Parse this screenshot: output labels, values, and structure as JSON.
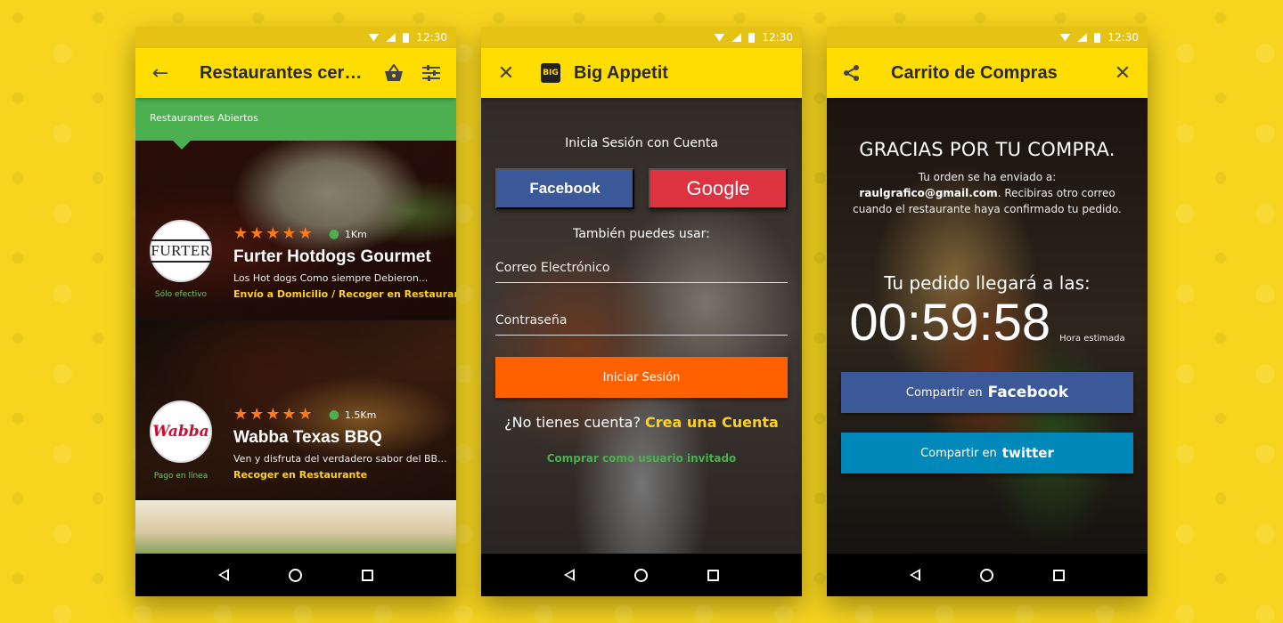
{
  "status_bar": {
    "time": "12:30"
  },
  "phone1": {
    "title": "Restaurantes cerca...",
    "banner": "Restaurantes Abiertos",
    "restaurants": [
      {
        "logo_text": "FURTER",
        "payment": "Sólo efectivo",
        "rating": 5,
        "distance": "1Km",
        "name": "Furter Hotdogs Gourmet",
        "description": "Los Hot dogs Como siempre Debieron...",
        "delivery": "Envío a Domicilio / Recoger en Restaurante"
      },
      {
        "logo_text": "Wabba",
        "payment": "Pago en línea",
        "rating": 5,
        "distance": "1.5Km",
        "name": "Wabba Texas BBQ",
        "description": "Ven y disfruta del verdadero sabor del BB...",
        "delivery": "Recoger en Restaurante"
      }
    ]
  },
  "phone2": {
    "title": "Big Appetit",
    "heading": "Inicia Sesión con Cuenta",
    "facebook_label": "Facebook",
    "google_label": "Google",
    "alt_text": "También puedes usar:",
    "email_placeholder": "Correo Electrónico",
    "password_placeholder": "Contraseña",
    "login_label": "Iniciar Sesión",
    "no_account": "¿No tienes cuenta?",
    "create_account": "Crea una Cuenta",
    "guest": "Comprar como usuario invitado"
  },
  "phone3": {
    "title": "Carrito de Compras",
    "thanks": "GRACIAS POR TU COMPRA.",
    "order_sent": "Tu orden se ha enviado a:",
    "email": "raulgrafico@gmail.com",
    "order_rest": ". Recibiras otro correo cuando el restaurante haya confirmado tu pedido.",
    "arrive": "Tu pedido llegará a las:",
    "timer": "00:59:58",
    "timer_label": "Hora estimada",
    "share_prefix": "Compartir en",
    "facebook_brand": "Facebook",
    "twitter_brand": "twitter"
  },
  "colors": {
    "background": "#f7d51f",
    "appbar": "#ffdd00",
    "green": "#4caf50",
    "orange": "#ff6000",
    "facebook": "#3b5998",
    "google": "#dd3340",
    "twitter": "#0088bb",
    "star": "#ff7a1a",
    "link_yellow": "#ffd21a"
  },
  "icons": {
    "phone1": [
      "arrow-back-icon",
      "basket-icon",
      "filter-icon"
    ],
    "phone2": [
      "close-icon",
      "big-appetit-logo"
    ],
    "phone3": [
      "share-icon",
      "close-icon"
    ],
    "card": [
      "star-icon",
      "location-pin-icon"
    ],
    "navbar": [
      "nav-back-icon",
      "nav-home-icon",
      "nav-recent-icon"
    ]
  }
}
